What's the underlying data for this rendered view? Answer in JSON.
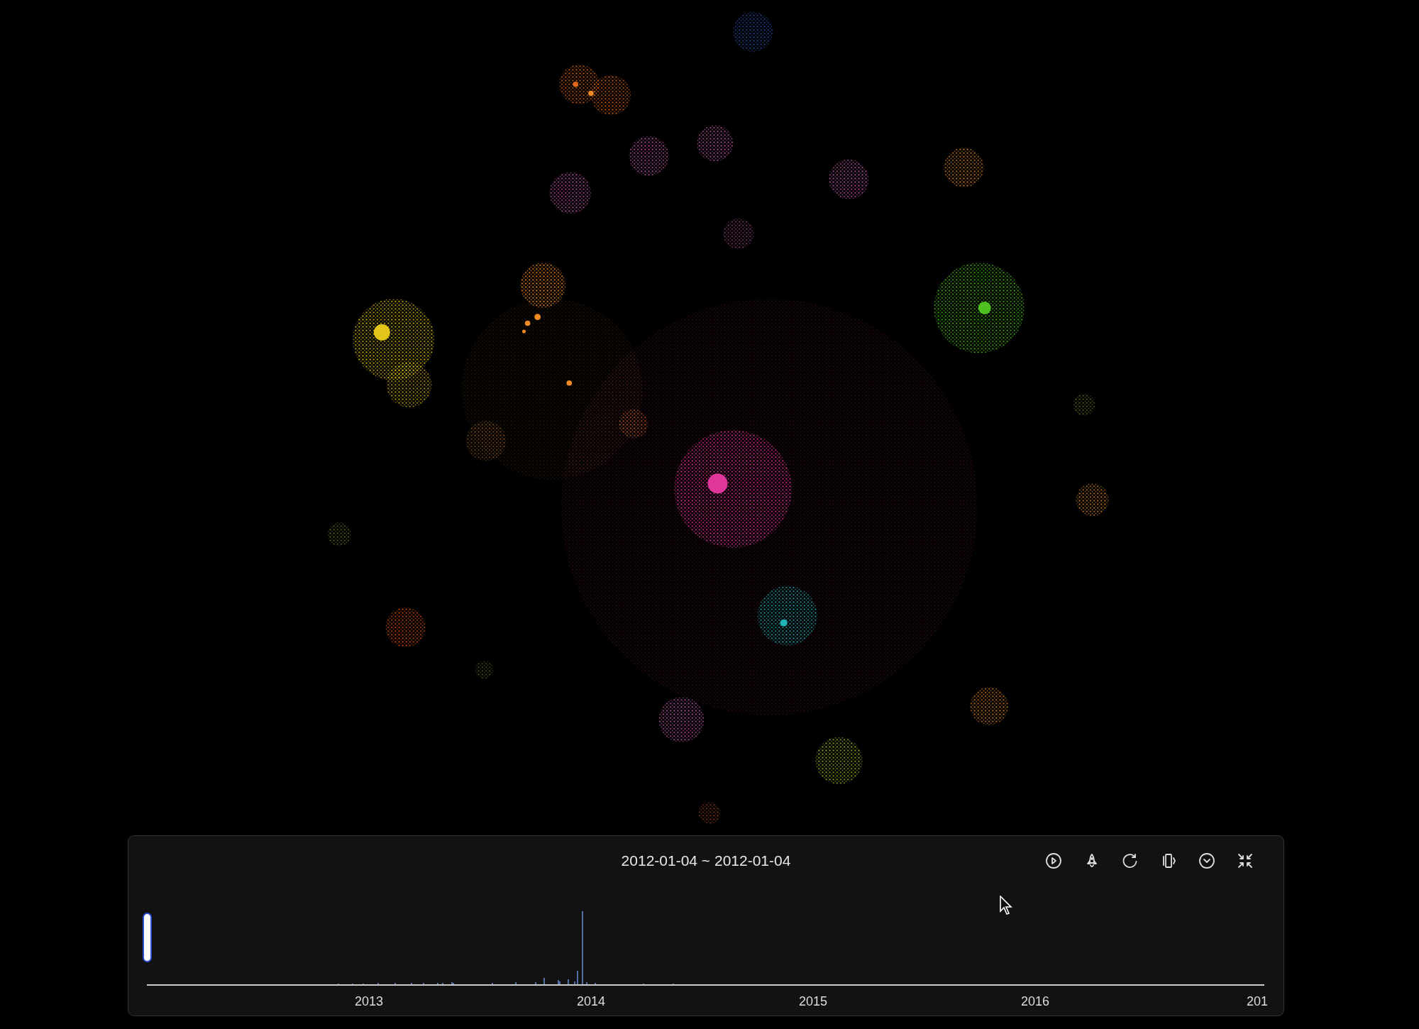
{
  "timeline": {
    "range_label": "2012-01-04 ~ 2012-01-04",
    "brush": {
      "level": 0
    },
    "axis_labels": [
      "2013",
      "2014",
      "2015",
      "2016",
      "201"
    ]
  },
  "toolbar": [
    {
      "kind": "play"
    },
    {
      "kind": "rocket"
    },
    {
      "kind": "refresh"
    },
    {
      "kind": "vibrate"
    },
    {
      "kind": "chevron"
    },
    {
      "kind": "shrink"
    }
  ]
}
